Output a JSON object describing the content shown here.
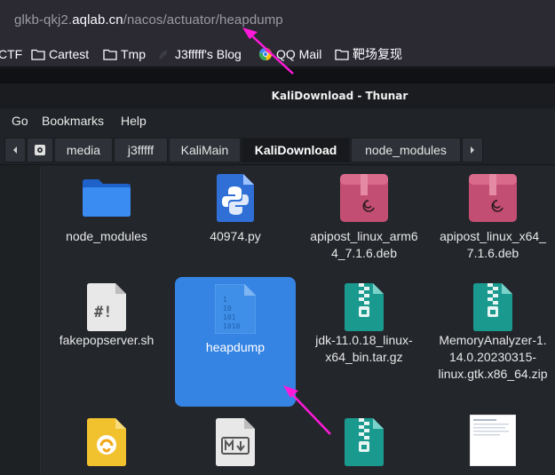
{
  "browser": {
    "url_prefix": "glkb-qkj2.",
    "url_host": "aqlab.cn",
    "url_path": "/nacos/actuator/heapdump",
    "bookmarks": [
      {
        "label": "CTF",
        "icon": "folder-icon"
      },
      {
        "label": "Cartest",
        "icon": "folder-icon"
      },
      {
        "label": "Tmp",
        "icon": "folder-icon"
      },
      {
        "label": "J3fffff's Blog",
        "icon": "site-icon"
      },
      {
        "label": "QQ Mail",
        "icon": "qq-mail-icon"
      },
      {
        "label": "靶场复现",
        "icon": "folder-icon"
      }
    ]
  },
  "window": {
    "title": "KaliDownload - Thunar",
    "menu": [
      "Go",
      "Bookmarks",
      "Help"
    ],
    "path": [
      "media",
      "j3fffff",
      "KaliMain",
      "KaliDownload",
      "node_modules"
    ],
    "active_path": "KaliDownload"
  },
  "files": [
    {
      "name": "node_modules",
      "icon": "folder-icon"
    },
    {
      "name": "40974.py",
      "icon": "python-file-icon"
    },
    {
      "name": "apipost_linux_arm64_7.1.6.deb",
      "display": [
        "apipost_linux_arm6",
        "4_7.1.6.deb"
      ],
      "icon": "debian-package-icon"
    },
    {
      "name": "apipost_linux_x64_7.1.6.deb",
      "display": [
        "apipost_linux_x64_",
        "7.1.6.deb"
      ],
      "icon": "debian-package-icon"
    },
    {
      "name": "fakepopserver.sh",
      "icon": "shell-script-icon"
    },
    {
      "name": "heapdump",
      "icon": "binary-file-icon",
      "selected": true
    },
    {
      "name": "jdk-11.0.18_linux-x64_bin.tar.gz",
      "display": [
        "jdk-11.0.18_linux-",
        "x64_bin.tar.gz"
      ],
      "icon": "archive-icon"
    },
    {
      "name": "MemoryAnalyzer-1.14.0.20230315-linux.gtk.x86_64.zip",
      "display": [
        "MemoryAnalyzer-1.",
        "14.0.20230315-",
        "linux.gtk.x86_64.zip"
      ],
      "icon": "archive-icon"
    },
    {
      "name": "",
      "icon": "app-package-icon"
    },
    {
      "name": "",
      "icon": "markdown-file-icon"
    },
    {
      "name": "",
      "icon": "archive-icon"
    },
    {
      "name": "",
      "icon": "image-thumbnail-icon"
    }
  ],
  "colors": {
    "selection": "#3584e4",
    "annotation_arrow": "#ff19d9"
  }
}
